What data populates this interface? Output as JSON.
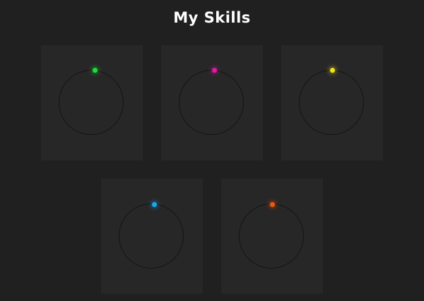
{
  "header": {
    "title": "My Skills"
  },
  "skills": [
    {
      "id": "skill-1",
      "color": "#1ee03a",
      "progress_fraction": 0.0
    },
    {
      "id": "skill-2",
      "color": "#e01aa6",
      "progress_fraction": 0.0
    },
    {
      "id": "skill-3",
      "color": "#f2e21a",
      "progress_fraction": 0.0
    },
    {
      "id": "skill-4",
      "color": "#18a8ee",
      "progress_fraction": 0.0
    },
    {
      "id": "skill-5",
      "color": "#f2580c",
      "progress_fraction": 0.0
    }
  ],
  "colors": {
    "background": "#202020",
    "card": "#272727",
    "ring": "#141414",
    "title": "#ffffff"
  }
}
